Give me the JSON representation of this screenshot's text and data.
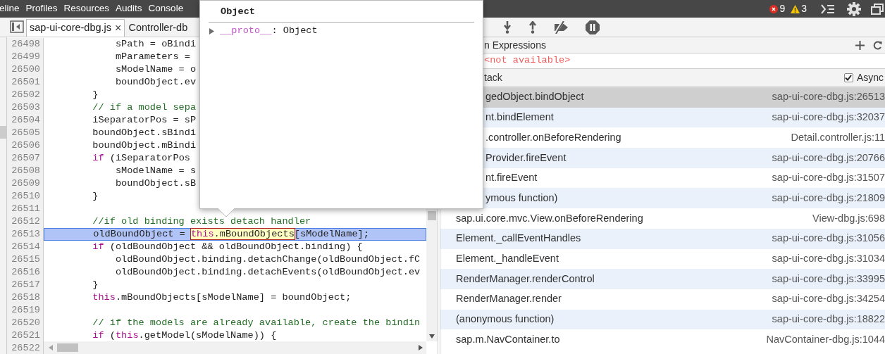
{
  "top_bar": {
    "tabs": [
      "eline",
      "Profiles",
      "Resources",
      "Audits",
      "Console"
    ],
    "errors": "9",
    "warnings": "3"
  },
  "editor": {
    "tabs": [
      {
        "label": "sap-ui-core-dbg.js",
        "selected": true,
        "close": "×"
      },
      {
        "label": "Controller-db",
        "selected": false
      }
    ],
    "lines": [
      {
        "number": "26498",
        "current": false,
        "segments": [
          {
            "text": "            sPath = oBindi",
            "kind": "plain"
          }
        ]
      },
      {
        "number": "26499",
        "current": false,
        "segments": [
          {
            "text": "            mParameters =",
            "kind": "plain"
          }
        ]
      },
      {
        "number": "26500",
        "current": false,
        "segments": [
          {
            "text": "            sModelName = o",
            "kind": "plain"
          }
        ]
      },
      {
        "number": "26501",
        "current": false,
        "segments": [
          {
            "text": "            boundObject.ev",
            "kind": "plain"
          }
        ]
      },
      {
        "number": "26502",
        "current": false,
        "segments": [
          {
            "text": "        }",
            "kind": "plain"
          }
        ]
      },
      {
        "number": "26503",
        "current": false,
        "segments": [
          {
            "text": "        // if a model sepa",
            "kind": "comment"
          }
        ]
      },
      {
        "number": "26504",
        "current": false,
        "segments": [
          {
            "text": "        iSeparatorPos = sP",
            "kind": "plain"
          }
        ]
      },
      {
        "number": "26505",
        "current": false,
        "segments": [
          {
            "text": "        boundObject.sBindi",
            "kind": "plain"
          }
        ]
      },
      {
        "number": "26506",
        "current": false,
        "segments": [
          {
            "text": "        boundObject.mBindi",
            "kind": "plain"
          }
        ]
      },
      {
        "number": "26507",
        "current": false,
        "segments": [
          {
            "text": "        if",
            "kind": "keyword"
          },
          {
            "text": " (iSeparatorPos",
            "kind": "plain"
          }
        ]
      },
      {
        "number": "26508",
        "current": false,
        "segments": [
          {
            "text": "            sModelName = s",
            "kind": "plain"
          }
        ]
      },
      {
        "number": "26509",
        "current": false,
        "segments": [
          {
            "text": "            boundObject.sB",
            "kind": "plain"
          }
        ]
      },
      {
        "number": "26510",
        "current": false,
        "segments": [
          {
            "text": "        }",
            "kind": "plain"
          }
        ]
      },
      {
        "number": "26511",
        "current": false
      },
      {
        "number": "26512",
        "current": false,
        "segments": [
          {
            "text": "        //if old binding exists detach handler",
            "kind": "comment"
          }
        ]
      },
      {
        "number": "26513",
        "current": true,
        "segments": [
          {
            "text": "        oldBoundObject = ",
            "kind": "plain"
          },
          {
            "text": "this",
            "kind": "keyword",
            "hovered": true
          },
          {
            "text": ".mBoundObjects",
            "kind": "plain",
            "hovered": true
          },
          {
            "text": "[sModelName];",
            "kind": "plain"
          }
        ]
      },
      {
        "number": "26514",
        "current": false,
        "segments": [
          {
            "text": "        if",
            "kind": "keyword"
          },
          {
            "text": " (oldBoundObject && oldBoundObject.binding) {",
            "kind": "plain"
          }
        ]
      },
      {
        "number": "26515",
        "current": false,
        "segments": [
          {
            "text": "            oldBoundObject.binding.detachChange(oldBoundObject.fC",
            "kind": "plain"
          }
        ]
      },
      {
        "number": "26516",
        "current": false,
        "segments": [
          {
            "text": "            oldBoundObject.binding.detachEvents(oldBoundObject.ev",
            "kind": "plain"
          }
        ]
      },
      {
        "number": "26517",
        "current": false,
        "segments": [
          {
            "text": "        }",
            "kind": "plain"
          }
        ]
      },
      {
        "number": "26518",
        "current": false,
        "segments": [
          {
            "text": "        this",
            "kind": "keyword"
          },
          {
            "text": ".mBoundObjects[sModelName] = boundObject;",
            "kind": "plain"
          }
        ]
      },
      {
        "number": "26519",
        "current": false
      },
      {
        "number": "26520",
        "current": false,
        "segments": [
          {
            "text": "        // if the models are already available, create the bindin",
            "kind": "comment"
          }
        ]
      },
      {
        "number": "26521",
        "current": false,
        "segments": [
          {
            "text": "        if",
            "kind": "keyword"
          },
          {
            "text": " (",
            "kind": "plain"
          },
          {
            "text": "this",
            "kind": "keyword"
          },
          {
            "text": ".getModel(sModelName)) {",
            "kind": "plain"
          }
        ]
      },
      {
        "number": "26522",
        "current": false
      }
    ]
  },
  "popover": {
    "title": "Object",
    "properties": [
      {
        "name": "__proto__",
        "value": ": Object",
        "expanded": false
      }
    ]
  },
  "debugger": {
    "watch": {
      "title": "n Expressions",
      "value": "<not available>"
    },
    "call_stack": {
      "title": "tack",
      "async_label": "Async",
      "async_checked": true,
      "frames": [
        {
          "name": "gedObject.bindObject",
          "location": "sap-ui-core-dbg.js:26513",
          "selected": true,
          "partly_hidden": true
        },
        {
          "name": "nt.bindElement",
          "location": "sap-ui-core-dbg.js:32037",
          "selected": false,
          "partly_hidden": true
        },
        {
          "name": ".controller.onBeforeRendering",
          "location": "Detail.controller.js:11",
          "selected": false,
          "partly_hidden": true
        },
        {
          "name": "Provider.fireEvent",
          "location": "sap-ui-core-dbg.js:20766",
          "selected": false,
          "partly_hidden": true
        },
        {
          "name": "nt.fireEvent",
          "location": "sap-ui-core-dbg.js:31507",
          "selected": false,
          "partly_hidden": true
        },
        {
          "name": "ymous function)",
          "location": "sap-ui-core-dbg.js:21809",
          "selected": false,
          "partly_hidden": true
        },
        {
          "name": "sap.ui.core.mvc.View.onBeforeRendering",
          "location": "View-dbg.js:698",
          "selected": false,
          "partly_hidden": false
        },
        {
          "name": "Element._callEventHandles",
          "location": "sap-ui-core-dbg.js:31056",
          "selected": false,
          "partly_hidden": false
        },
        {
          "name": "Element._handleEvent",
          "location": "sap-ui-core-dbg.js:31034",
          "selected": false,
          "partly_hidden": false
        },
        {
          "name": "RenderManager.renderControl",
          "location": "sap-ui-core-dbg.js:33995",
          "selected": false,
          "partly_hidden": false
        },
        {
          "name": "RenderManager.render",
          "location": "sap-ui-core-dbg.js:34254",
          "selected": false,
          "partly_hidden": false
        },
        {
          "name": "(anonymous function)",
          "location": "sap-ui-core-dbg.js:18822",
          "selected": false,
          "partly_hidden": false
        },
        {
          "name": "sap.m.NavContainer.to",
          "location": "NavContainer-dbg.js:1044",
          "selected": false,
          "partly_hidden": false
        }
      ]
    }
  }
}
